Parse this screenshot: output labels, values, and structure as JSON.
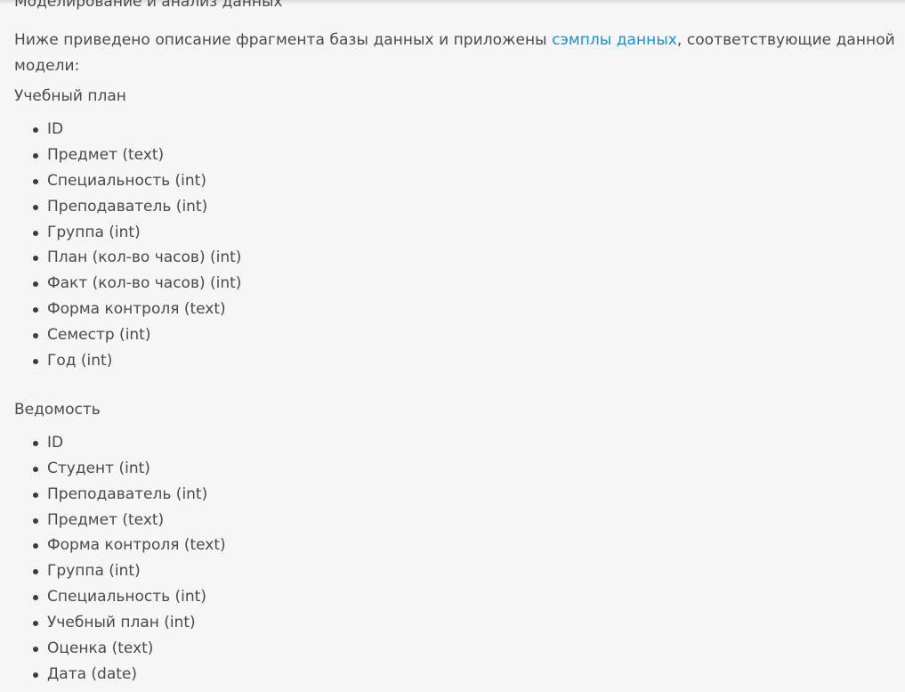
{
  "heading": "Моделирование и анализ данных",
  "intro": {
    "before_link": "Ниже приведено описание фрагмента базы данных и приложены ",
    "link_text": "сэмплы данных",
    "after_link": ", соответствующие данной модели:"
  },
  "colors": {
    "text": "#4a4a4a",
    "link": "#1a8fd6",
    "background": "#f6f6f6"
  },
  "sections": [
    {
      "title": "Учебный план",
      "fields": [
        "ID",
        "Предмет (text)",
        "Специальность (int)",
        "Преподаватель (int)",
        "Группа (int)",
        "План (кол-во часов) (int)",
        "Факт (кол-во часов) (int)",
        "Форма контроля (text)",
        "Семестр (int)",
        "Год (int)"
      ]
    },
    {
      "title": "Ведомость",
      "fields": [
        "ID",
        "Студент (int)",
        "Преподаватель (int)",
        "Предмет (text)",
        "Форма контроля (text)",
        "Группа (int)",
        "Специальность (int)",
        "Учебный план (int)",
        "Оценка (text)",
        "Дата (date)"
      ]
    }
  ]
}
